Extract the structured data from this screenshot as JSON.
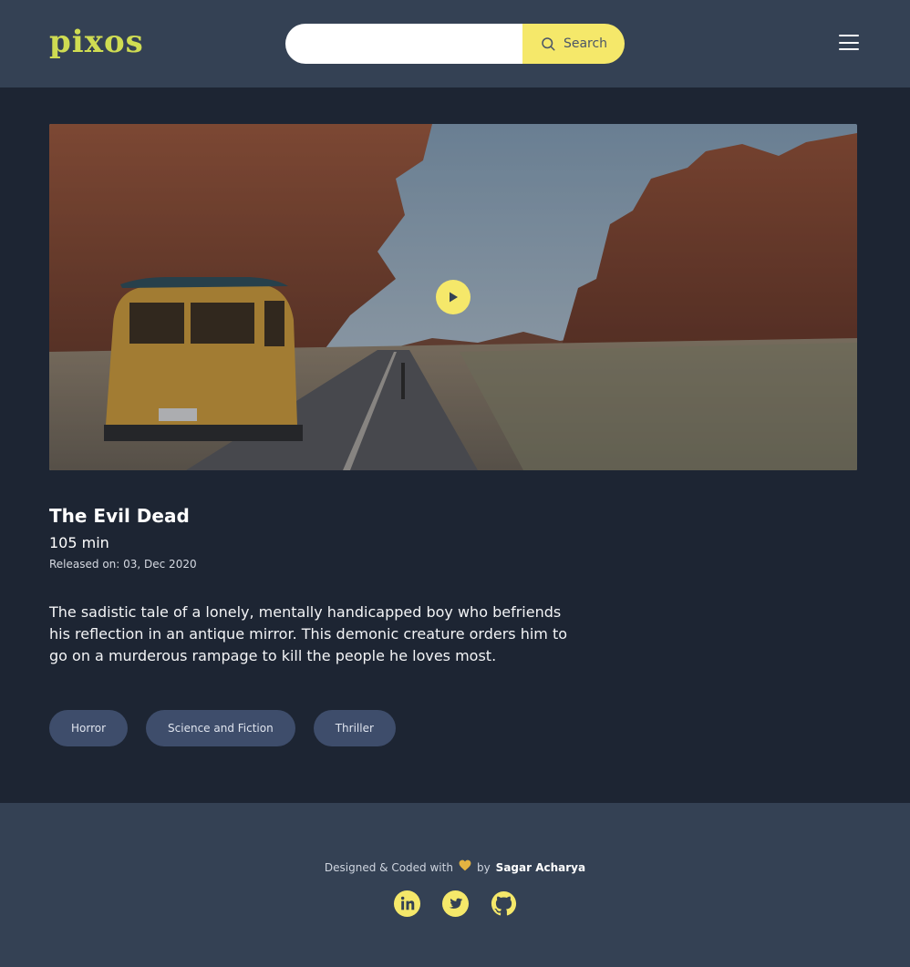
{
  "header": {
    "logo": "pixos",
    "search": {
      "placeholder": "",
      "value": "",
      "button_label": "Search"
    },
    "menu_icon": "hamburger-icon"
  },
  "hero": {
    "image": "van-driving-through-red-rock-canyon",
    "play_icon": "play-icon"
  },
  "movie": {
    "title": "The Evil Dead",
    "duration": "105 min",
    "released": "Released on: 03, Dec 2020",
    "description": "The sadistic tale of a lonely, mentally handicapped boy who befriends his reflection in an antique mirror. This demonic creature orders him to go on a murderous rampage to kill the people he loves most.",
    "genres": [
      "Horror",
      "Science and Fiction",
      "Thriller"
    ]
  },
  "footer": {
    "credit_prefix": "Designed & Coded with",
    "credit_by": "by",
    "author": "Sagar Acharya",
    "heart_icon": "heart-icon",
    "socials": [
      "linkedin-icon",
      "twitter-icon",
      "github-icon"
    ]
  },
  "colors": {
    "background": "#1d2533",
    "header": "#344154",
    "accent": "#f5e86a",
    "logo": "#cfdc52",
    "genre_pill": "#3e4d6b"
  }
}
